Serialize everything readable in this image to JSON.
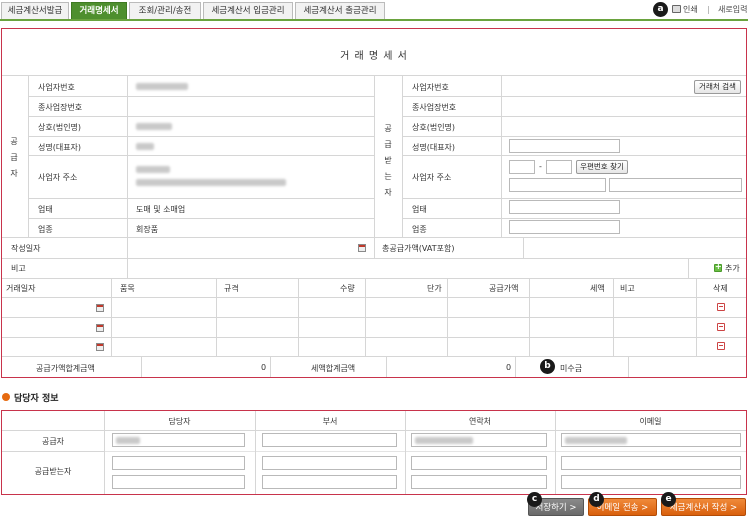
{
  "tabs": [
    "세금계산서발급",
    "거래명세서",
    "조회/관리/송전",
    "세금계산서 입금관리",
    "세금계산서 출금관리"
  ],
  "top_links": {
    "print": "인쇄",
    "new": "새로입력"
  },
  "badges": {
    "a": "a",
    "b": "b",
    "c": "c",
    "d": "d",
    "e": "e"
  },
  "form": {
    "title": "거 래 명 세 서",
    "supplier_vertical": "공급자",
    "receiver_vertical": "공급받는자",
    "supplier_labels": [
      "사업자번호",
      "종사업장번호",
      "상호(법인명)",
      "성명(대표자)",
      "사업자 주소",
      "업태",
      "업종"
    ],
    "supplier_values": {
      "business_type": "도매 및 소매업",
      "business_item": "회장품"
    },
    "receiver_labels": [
      "사업자번호",
      "종사업장번호",
      "상호(법인명)",
      "성명(대표자)",
      "사업자 주소",
      "업태",
      "업종"
    ],
    "search_button": "거래처 검색",
    "postal_button": "우편번호 찾기",
    "postal_dash": "-",
    "write_date_label": "작성일자",
    "total_supply_label": "총공급가액(VAT포함)",
    "note_label": "비고",
    "add_label": "추가",
    "item_headers": [
      "거래일자",
      "품목",
      "규격",
      "수량",
      "단가",
      "공급가액",
      "세액",
      "비고",
      "삭제"
    ],
    "sum_supply_label": "공급가액합계금액",
    "sum_supply_value": "0",
    "sum_tax_label": "세액합계금액",
    "sum_tax_value": "0",
    "unpaid_label": "미수금"
  },
  "manager": {
    "title": "담당자 정보",
    "headers": [
      "담당자",
      "부서",
      "연락처",
      "이메일"
    ],
    "rows": [
      "공급자",
      "공급받는자"
    ]
  },
  "buttons": {
    "save": "저장하기 >",
    "email": "이메일 전송 >",
    "issue": "세금계산서 작성 >"
  }
}
